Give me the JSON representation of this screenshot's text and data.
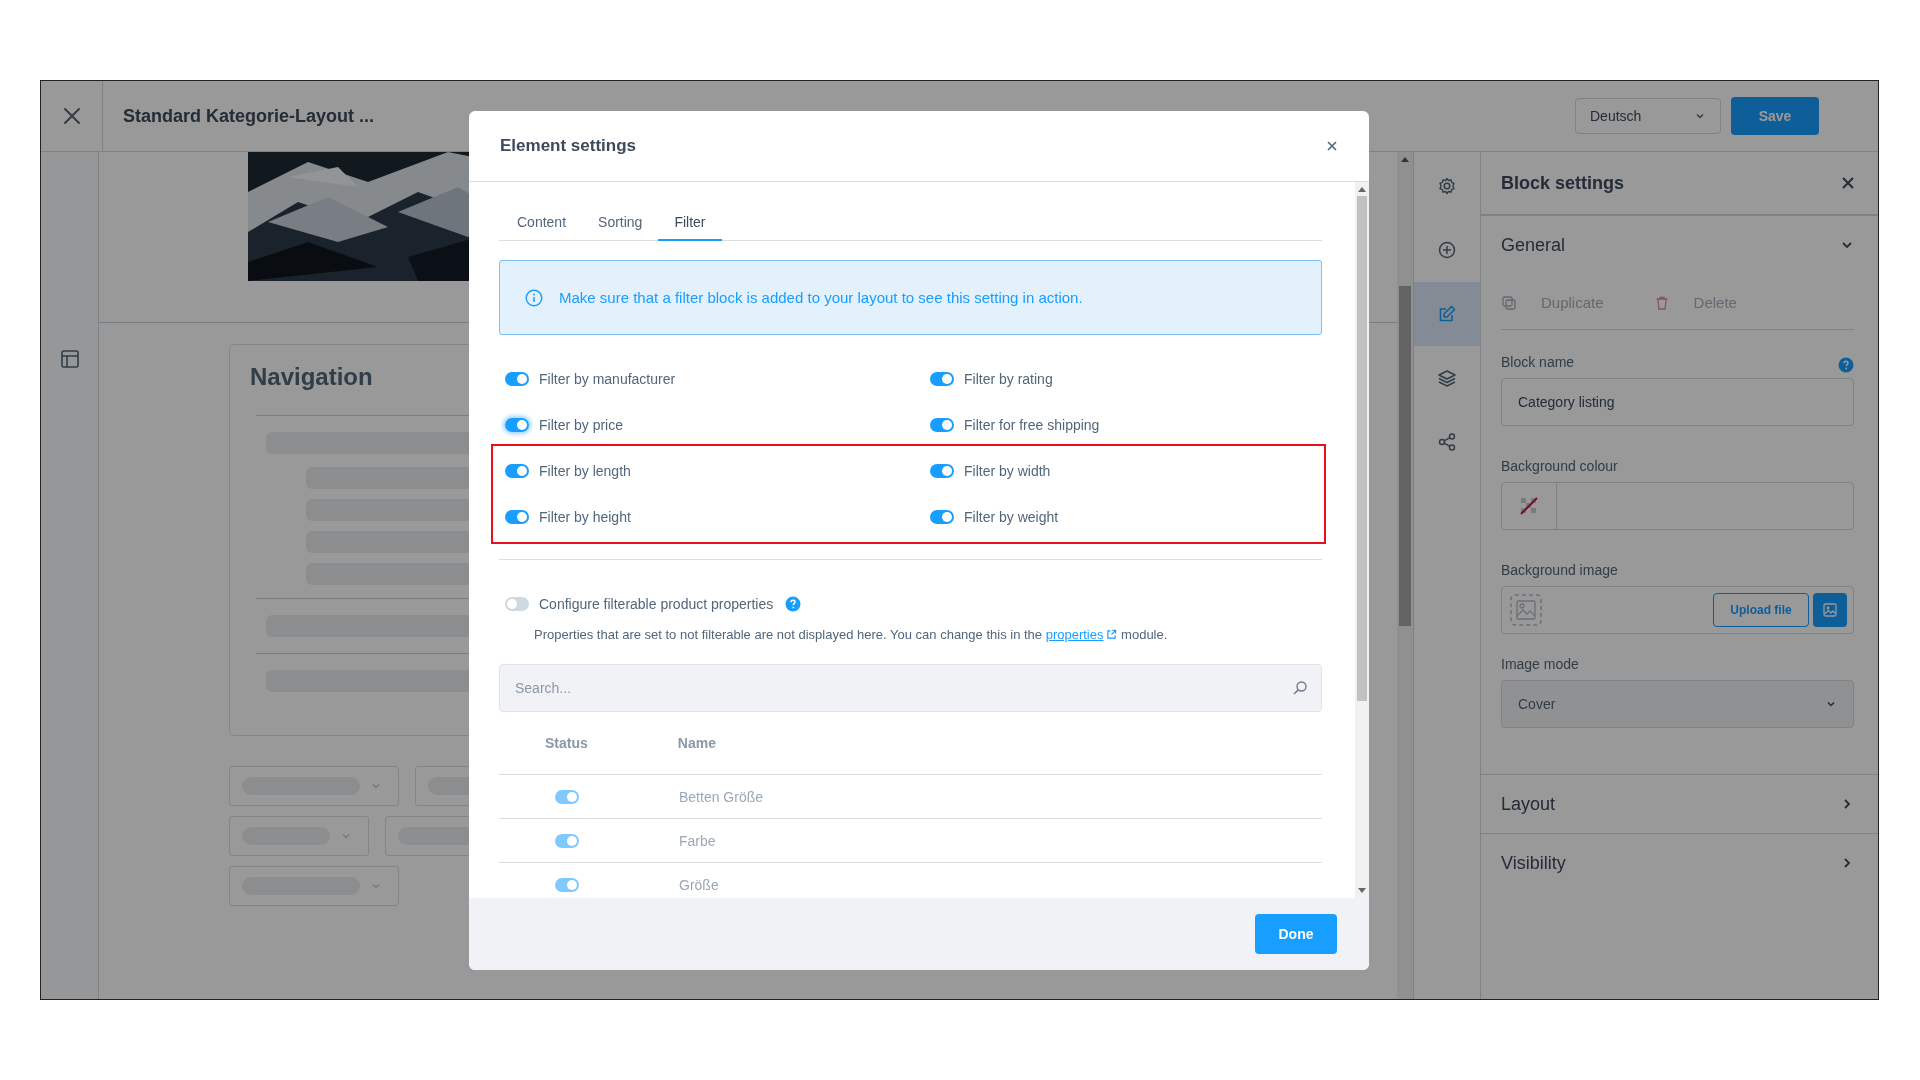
{
  "header": {
    "title": "Standard Kategorie-Layout ...",
    "language": "Deutsch",
    "save": "Save"
  },
  "canvas": {
    "navigation_title": "Navigation"
  },
  "rail": [
    {
      "kind": "settings",
      "selected": false
    },
    {
      "kind": "add",
      "selected": false
    },
    {
      "kind": "edit",
      "selected": true
    },
    {
      "kind": "layers",
      "selected": false
    },
    {
      "kind": "share",
      "selected": false
    }
  ],
  "modal": {
    "title": "Element settings",
    "tabs": [
      {
        "label": "Content",
        "selected": false
      },
      {
        "label": "Sorting",
        "selected": false
      },
      {
        "label": "Filter",
        "selected": true
      }
    ],
    "info": "Make sure that a filter block is added to your layout to see this setting in action.",
    "filter_groups": [
      {
        "highlighted": false,
        "items": [
          {
            "label": "Filter by manufacturer",
            "on": true,
            "focused": false
          },
          {
            "label": "Filter by rating",
            "on": true,
            "focused": false
          },
          {
            "label": "Filter by price",
            "on": true,
            "focused": true
          },
          {
            "label": "Filter for free shipping",
            "on": true,
            "focused": false
          }
        ]
      },
      {
        "highlighted": true,
        "items": [
          {
            "label": "Filter by length",
            "on": true,
            "focused": false
          },
          {
            "label": "Filter by width",
            "on": true,
            "focused": false
          },
          {
            "label": "Filter by height",
            "on": true,
            "focused": false
          },
          {
            "label": "Filter by weight",
            "on": true,
            "focused": false
          }
        ]
      }
    ],
    "configure": {
      "label": "Configure filterable product properties",
      "on": false
    },
    "note": {
      "before": "Properties that are set to not filterable are not displayed here. You can change this in the",
      "link": "properties",
      "after": "module."
    },
    "search": {
      "placeholder": "Search..."
    },
    "table": {
      "columns": [
        "Status",
        "Name"
      ],
      "disabled": true,
      "rows": [
        {
          "name": "Betten Größe",
          "on": true
        },
        {
          "name": "Farbe",
          "on": true
        },
        {
          "name": "Größe",
          "on": true
        }
      ]
    },
    "done": "Done"
  },
  "panel": {
    "title": "Block settings",
    "general": {
      "title": "General",
      "expanded": true,
      "actions": [
        {
          "kind": "duplicate",
          "label": "Duplicate",
          "disabled": true
        },
        {
          "kind": "delete",
          "label": "Delete",
          "disabled": true
        }
      ],
      "block_name": {
        "label": "Block name",
        "value": "Category listing"
      },
      "background_colour": {
        "label": "Background colour"
      },
      "background_image": {
        "label": "Background image",
        "upload": "Upload file"
      },
      "image_mode": {
        "label": "Image mode",
        "value": "Cover"
      }
    },
    "sections": [
      {
        "title": "Layout",
        "expanded": false
      },
      {
        "title": "Visibility",
        "expanded": false
      }
    ]
  }
}
